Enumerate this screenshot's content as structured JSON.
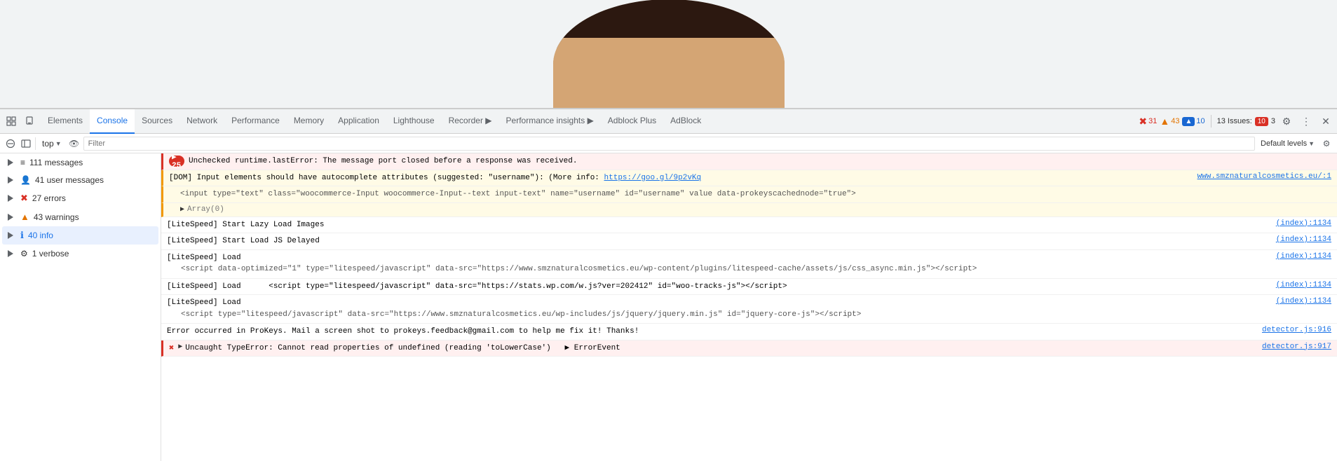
{
  "browser": {
    "top_height": 155
  },
  "tabs": {
    "items": [
      {
        "label": "Elements",
        "active": false
      },
      {
        "label": "Console",
        "active": true
      },
      {
        "label": "Sources",
        "active": false
      },
      {
        "label": "Network",
        "active": false
      },
      {
        "label": "Performance",
        "active": false
      },
      {
        "label": "Memory",
        "active": false
      },
      {
        "label": "Application",
        "active": false
      },
      {
        "label": "Lighthouse",
        "active": false
      },
      {
        "label": "Recorder",
        "active": false
      },
      {
        "label": "Performance insights",
        "active": false
      },
      {
        "label": "Adblock Plus",
        "active": false
      },
      {
        "label": "AdBlock",
        "active": false
      }
    ],
    "error_count": "31",
    "warning_count": "43",
    "info_count": "10",
    "issues_label": "13 Issues:",
    "issues_error": "10",
    "issues_warn": "3"
  },
  "toolbar": {
    "context": "top",
    "filter_placeholder": "Filter",
    "levels_label": "Default levels"
  },
  "sidebar": {
    "items": [
      {
        "label": "111 messages",
        "icon": "list",
        "count": "",
        "type": "all"
      },
      {
        "label": "41 user messages",
        "icon": "person",
        "count": "",
        "type": "user"
      },
      {
        "label": "27 errors",
        "icon": "error",
        "count": "",
        "type": "error"
      },
      {
        "label": "43 warnings",
        "icon": "warning",
        "count": "",
        "type": "warning"
      },
      {
        "label": "40 info",
        "icon": "info",
        "count": "",
        "type": "info",
        "active": true
      },
      {
        "label": "1 verbose",
        "icon": "gear",
        "count": "",
        "type": "verbose"
      }
    ]
  },
  "console": {
    "entries": [
      {
        "type": "error",
        "badge": "25",
        "text": "Unchecked runtime.lastError: The message port closed before a response was received.",
        "source": ""
      },
      {
        "type": "warn",
        "text": "[DOM] Input elements should have autocomplete attributes (suggested: \"username\"): (More info: ",
        "link_text": "https://goo.gl/9p2vKq",
        "link_url": "https://goo.gl/9p2vKq",
        "text2": "",
        "source": "www.smznaturalcosmetics.eu/:1"
      },
      {
        "type": "warn_code",
        "text": "<input type=\"text\" class=\"woocommerce-Input woocommerce-Input--text input-text\" name=\"username\" id=\"username\" value data-prokeyscachednode=\"true\">",
        "source": ""
      },
      {
        "type": "expand",
        "text": "Array(0)",
        "source": ""
      },
      {
        "type": "info",
        "text": "[LiteSpeed] Start Lazy Load Images",
        "source": "(index):1134"
      },
      {
        "type": "info",
        "text": "[LiteSpeed] Start Load JS Delayed",
        "source": "(index):1134"
      },
      {
        "type": "info_multiline",
        "text": "[LiteSpeed] Load",
        "source": "(index):1134",
        "code": "<script data-optimized=\"1\" type=\"litespeed/javascript\" data-src=\"https://www.smznaturalcosmetics.eu/wp-content/plugins/litespeed-cache/assets/js/css_async.min.js\"></script>"
      },
      {
        "type": "info",
        "text": "[LiteSpeed] Load     <script type=\"litespeed/javascript\" data-src=\"https://stats.wp.com/w.js?ver=202412\" id=\"woo-tracks-js\"></script>",
        "source": "(index):1134"
      },
      {
        "type": "info_multiline",
        "text": "[LiteSpeed] Load",
        "source": "(index):1134",
        "code": "<script type=\"litespeed/javascript\" data-src=\"https://www.smznaturalcosmetics.eu/wp-includes/js/jquery/jquery.min.js\" id=\"jquery-core-js\"></script>"
      },
      {
        "type": "info",
        "text": "Error occurred in ProKeys. Mail a screen shot to prokeys.feedback@gmail.com to help me fix it! Thanks!",
        "source": "detector.js:916"
      },
      {
        "type": "error_bottom",
        "text": "▶ Uncaught TypeError: Cannot read properties of undefined (reading 'toLowerCase')  ▶ ErrorEvent",
        "source": "detector.js:917"
      }
    ]
  }
}
